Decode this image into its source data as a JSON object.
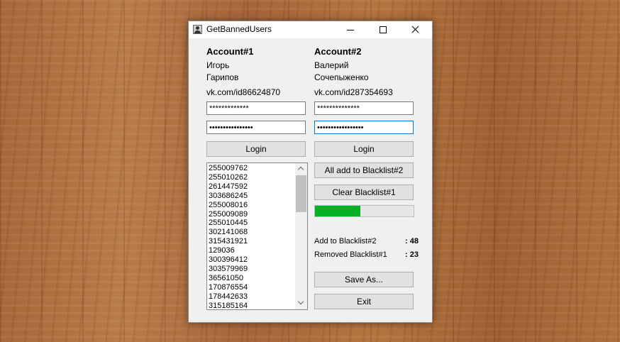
{
  "window": {
    "title": "GetBannedUsers"
  },
  "account1": {
    "heading": "Account#1",
    "first_name": "Игорь",
    "last_name": "Гарипов",
    "link": "vk.com/id86624870",
    "login_value": "*************",
    "password_value": "••••••••••••••••",
    "login_button": "Login"
  },
  "account2": {
    "heading": "Account#2",
    "first_name": "Валерий",
    "last_name": "Сочепыженко",
    "link": "vk.com/id287354693",
    "login_value": "**************",
    "password_value": "•••••••••••••••••",
    "login_button": "Login"
  },
  "id_list": [
    "255009762",
    "255010262",
    "261447592",
    "303686245",
    "255008016",
    "255009089",
    "255010445",
    "302141068",
    "315431921",
    "129036",
    "300396412",
    "303579969",
    "36561050",
    "170876554",
    "178442633",
    "315185164"
  ],
  "actions": {
    "add_all": "All add to Blacklist#2",
    "clear": "Clear Blacklist#1",
    "save_as": "Save As...",
    "exit": "Exit"
  },
  "progress": {
    "fraction": 0.46,
    "color": "#06b025"
  },
  "stats": {
    "added_label": "Add to Blacklist#2",
    "added_value": ": 48",
    "removed_label": "Removed Blacklist#1",
    "removed_value": ": 23"
  }
}
